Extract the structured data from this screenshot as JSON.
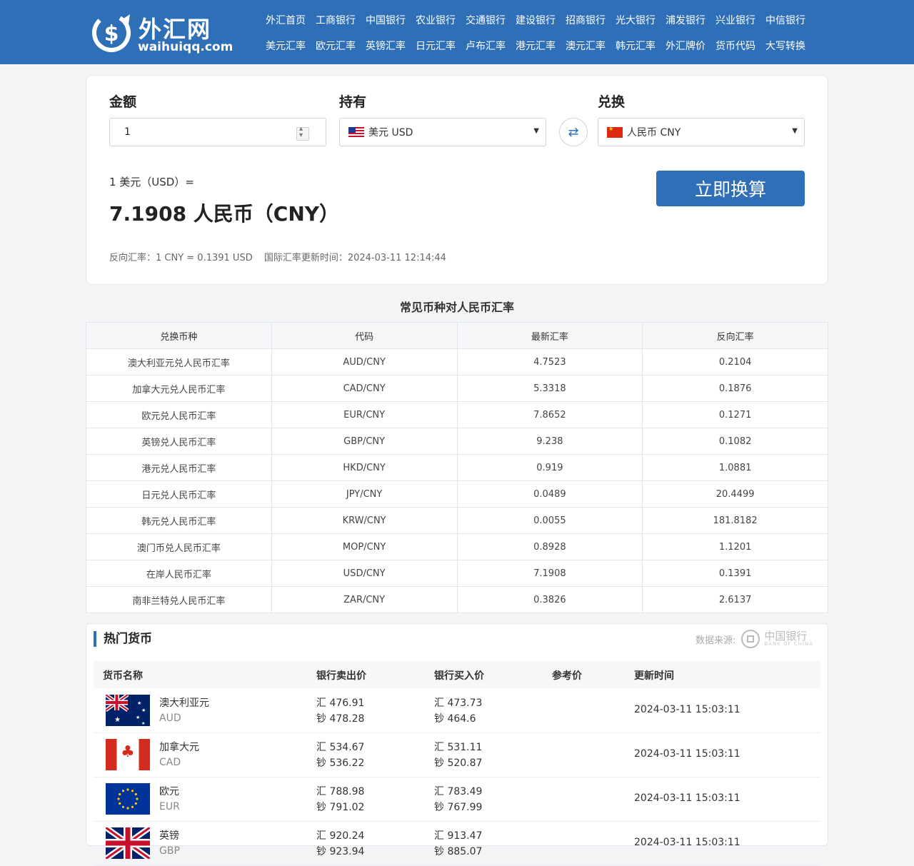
{
  "logo": {
    "cn": "外汇网",
    "en": "waihuiqq.com"
  },
  "nav": {
    "row1": [
      "外汇首页",
      "工商银行",
      "中国银行",
      "农业银行",
      "交通银行",
      "建设银行",
      "招商银行",
      "光大银行",
      "浦发银行",
      "兴业银行",
      "中信银行"
    ],
    "row2": [
      "美元汇率",
      "欧元汇率",
      "英镑汇率",
      "日元汇率",
      "卢布汇率",
      "港元汇率",
      "澳元汇率",
      "韩元汇率",
      "外汇牌价",
      "货币代码",
      "大写转换"
    ]
  },
  "converter": {
    "amount_label": "金额",
    "hold_label": "持有",
    "to_label": "兑换",
    "amount_value": "1",
    "from_currency": "美元 USD",
    "to_currency": "人民币 CNY",
    "result_top": "1 美元（USD）=",
    "result_main": "7.1908 人民币（CNY）",
    "button": "立即换算",
    "reverse_rate": "反向汇率：1 CNY = 0.1391 USD",
    "update_time": "国际汇率更新时间：2024-03-11 12:14:44"
  },
  "rates": {
    "title": "常见币种对人民币汇率",
    "headers": [
      "兑换币种",
      "代码",
      "最新汇率",
      "反向汇率"
    ],
    "rows": [
      [
        "澳大利亚元兑人民币汇率",
        "AUD/CNY",
        "4.7523",
        "0.2104"
      ],
      [
        "加拿大元兑人民币汇率",
        "CAD/CNY",
        "5.3318",
        "0.1876"
      ],
      [
        "欧元兑人民币汇率",
        "EUR/CNY",
        "7.8652",
        "0.1271"
      ],
      [
        "英镑兑人民币汇率",
        "GBP/CNY",
        "9.238",
        "0.1082"
      ],
      [
        "港元兑人民币汇率",
        "HKD/CNY",
        "0.919",
        "1.0881"
      ],
      [
        "日元兑人民币汇率",
        "JPY/CNY",
        "0.0489",
        "20.4499"
      ],
      [
        "韩元兑人民币汇率",
        "KRW/CNY",
        "0.0055",
        "181.8182"
      ],
      [
        "澳门币兑人民币汇率",
        "MOP/CNY",
        "0.8928",
        "1.1201"
      ],
      [
        "在岸人民币汇率",
        "USD/CNY",
        "7.1908",
        "0.1391"
      ],
      [
        "南非兰特兑人民币汇率",
        "ZAR/CNY",
        "0.3826",
        "2.6137"
      ]
    ]
  },
  "hot": {
    "title": "热门货币",
    "source_label": "数据来源:",
    "source_name_cn": "中国银行",
    "source_name_en": "BANK OF CHINA",
    "headers": {
      "name": "货币名称",
      "sell": "银行卖出价",
      "buy": "银行买入价",
      "ref": "参考价",
      "time": "更新时间"
    },
    "rows": [
      {
        "name": "澳大利亚元",
        "code": "AUD",
        "sell_h": "汇 476.91",
        "sell_c": "钞 478.28",
        "buy_h": "汇 473.73",
        "buy_c": "钞 464.6",
        "time": "2024-03-11 15:03:11",
        "flag": "australia-flag"
      },
      {
        "name": "加拿大元",
        "code": "CAD",
        "sell_h": "汇 534.67",
        "sell_c": "钞 536.22",
        "buy_h": "汇 531.11",
        "buy_c": "钞 520.87",
        "time": "2024-03-11 15:03:11",
        "flag": "canada-flag"
      },
      {
        "name": "欧元",
        "code": "EUR",
        "sell_h": "汇 788.98",
        "sell_c": "钞 791.02",
        "buy_h": "汇 783.49",
        "buy_c": "钞 767.99",
        "time": "2024-03-11 15:03:11",
        "flag": "eu-flag"
      },
      {
        "name": "英镑",
        "code": "GBP",
        "sell_h": "汇 920.24",
        "sell_c": "钞 923.94",
        "buy_h": "汇 913.47",
        "buy_c": "钞 885.07",
        "time": "2024-03-11 15:03:11",
        "flag": "uk-flag"
      }
    ]
  },
  "colors": {
    "brand": "#2f6fb7",
    "background": "#f3f4f6"
  }
}
